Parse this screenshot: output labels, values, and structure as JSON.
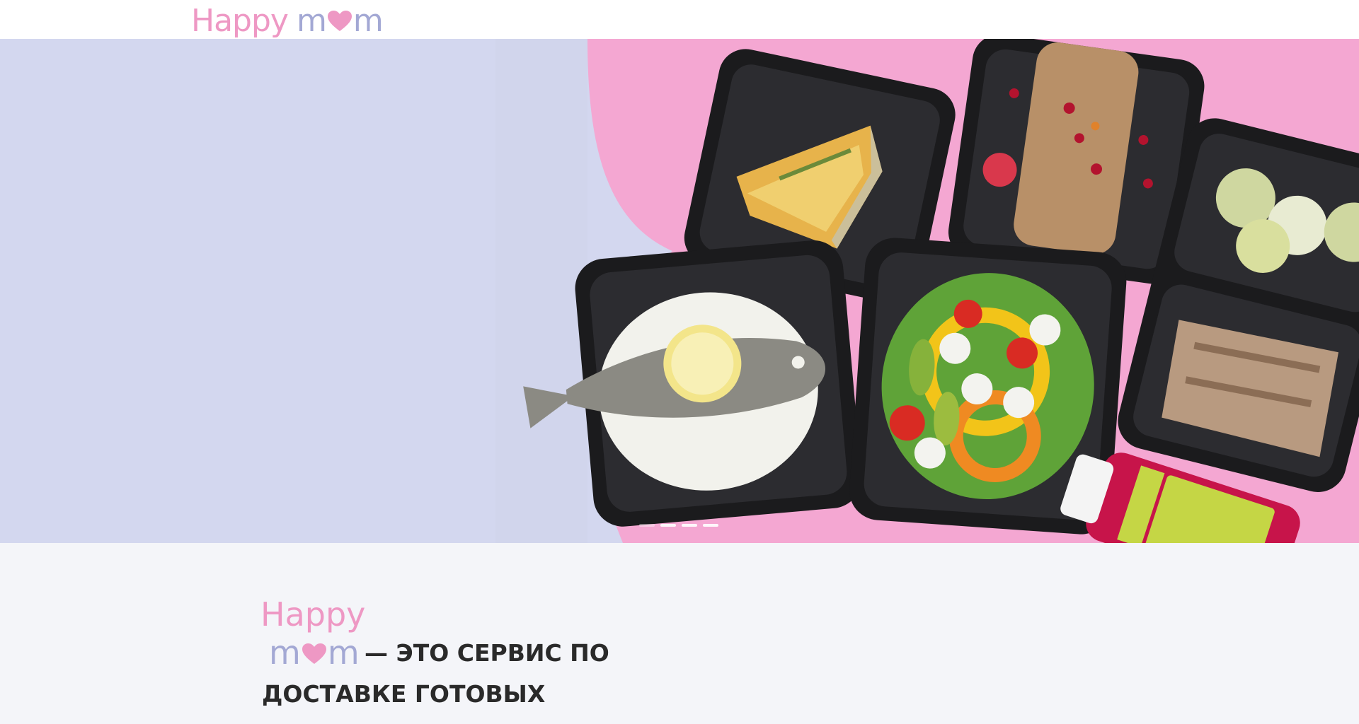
{
  "header": {
    "logo_happy": "Happy",
    "logo_mom_m1": "m",
    "logo_mom_m2": "m"
  },
  "hero": {
    "slides_count": 4,
    "active_slide": 1,
    "image": "ready-meals-in-containers"
  },
  "about": {
    "logo_happy": "Happy",
    "logo_mom_m1": "m",
    "logo_mom_m2": "m",
    "text": "— это сервис по доставке готовых"
  },
  "colors": {
    "pink": "#ee98c4",
    "lavender": "#a3a8d4",
    "hero_bg": "#d3d7ef",
    "hero_pink": "#f4a7d2"
  }
}
